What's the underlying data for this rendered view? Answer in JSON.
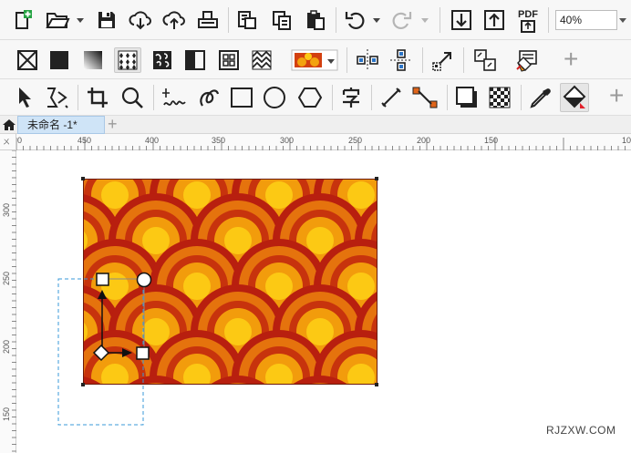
{
  "toolbar_top": {
    "pdf_label": "PDF",
    "zoom_value": "40%"
  },
  "tabbar": {
    "document_tab": "未命名 -1*",
    "add_tab": "+"
  },
  "ruler": {
    "horizontal_ticks": [
      "0",
      "450",
      "400",
      "350",
      "300",
      "250",
      "200",
      "150",
      "10"
    ],
    "vertical_ticks": [
      "300",
      "250",
      "200",
      "150"
    ],
    "corner_label": "ㄨ"
  },
  "watermark": "RJZXW.COM",
  "icons": {
    "tb1": [
      "new-document-icon",
      "open-folder-icon",
      "save-icon",
      "cloud-download-icon",
      "cloud-upload-icon",
      "print-icon",
      "paste-format-icon",
      "copy-icon",
      "paste-icon",
      "undo-icon",
      "redo-icon",
      "import-icon",
      "export-icon",
      "export-pdf-icon"
    ],
    "tb2": [
      "no-fill-icon",
      "uniform-fill-icon",
      "fountain-fill-icon",
      "pattern-fill-icon",
      "texture-fill-icon",
      "postscript-fill-icon",
      "two-color-pattern-icon",
      "vector-pattern-icon",
      "bitmap-pattern-icon",
      "pattern-swatch-icon",
      "mirror-tile-horizontal-icon",
      "mirror-tile-vertical-icon",
      "transform-with-object-icon",
      "scale-with-object-icon",
      "edit-fill-icon"
    ],
    "tb3": [
      "pick-tool-icon",
      "shape-tool-icon",
      "crop-tool-icon",
      "zoom-tool-icon",
      "freehand-tool-icon",
      "artistic-media-icon",
      "rectangle-tool-icon",
      "ellipse-tool-icon",
      "polygon-tool-icon",
      "text-tool-icon",
      "parallel-dimension-icon",
      "connector-tool-icon",
      "drop-shadow-icon",
      "transparency-icon",
      "eyedropper-icon",
      "interactive-fill-icon"
    ]
  },
  "colors": {
    "pattern_dark_red": "#b81f0f",
    "pattern_orange": "#e5730d",
    "pattern_amber": "#f29c0c",
    "pattern_yellow": "#fcc914",
    "selection_dashed": "#3a9ad9",
    "tab_active": "#cfe4f7"
  }
}
